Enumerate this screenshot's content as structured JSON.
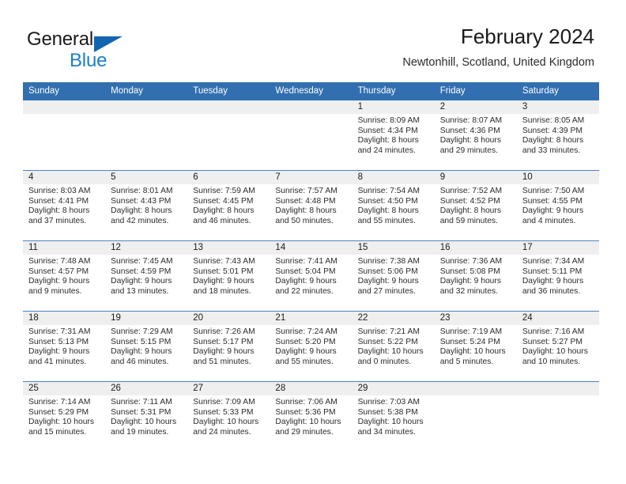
{
  "brand": {
    "name_part1": "General",
    "name_part2": "Blue",
    "logo_icon": "blue-triangle-icon"
  },
  "header": {
    "title": "February 2024",
    "subtitle": "Newtonhill, Scotland, United Kingdom"
  },
  "colors": {
    "header_blue": "#316fb0",
    "brand_blue": "#1a7ed1",
    "daynum_strip": "#efefef",
    "row_separator": "#4a86c4",
    "text": "#2b2b2b"
  },
  "weekday_headers": [
    "Sunday",
    "Monday",
    "Tuesday",
    "Wednesday",
    "Thursday",
    "Friday",
    "Saturday"
  ],
  "labels": {
    "sunrise_prefix": "Sunrise:",
    "sunset_prefix": "Sunset:",
    "daylight_prefix": "Daylight:"
  },
  "weeks": [
    [
      {
        "day": "",
        "empty": true,
        "line1": "",
        "line2": "",
        "line3": "",
        "line4": ""
      },
      {
        "day": "",
        "empty": true,
        "line1": "",
        "line2": "",
        "line3": "",
        "line4": ""
      },
      {
        "day": "",
        "empty": true,
        "line1": "",
        "line2": "",
        "line3": "",
        "line4": ""
      },
      {
        "day": "",
        "empty": true,
        "line1": "",
        "line2": "",
        "line3": "",
        "line4": ""
      },
      {
        "day": "1",
        "empty": false,
        "line1": "Sunrise: 8:09 AM",
        "line2": "Sunset: 4:34 PM",
        "line3": "Daylight: 8 hours",
        "line4": "and 24 minutes."
      },
      {
        "day": "2",
        "empty": false,
        "line1": "Sunrise: 8:07 AM",
        "line2": "Sunset: 4:36 PM",
        "line3": "Daylight: 8 hours",
        "line4": "and 29 minutes."
      },
      {
        "day": "3",
        "empty": false,
        "line1": "Sunrise: 8:05 AM",
        "line2": "Sunset: 4:39 PM",
        "line3": "Daylight: 8 hours",
        "line4": "and 33 minutes."
      }
    ],
    [
      {
        "day": "4",
        "empty": false,
        "line1": "Sunrise: 8:03 AM",
        "line2": "Sunset: 4:41 PM",
        "line3": "Daylight: 8 hours",
        "line4": "and 37 minutes."
      },
      {
        "day": "5",
        "empty": false,
        "line1": "Sunrise: 8:01 AM",
        "line2": "Sunset: 4:43 PM",
        "line3": "Daylight: 8 hours",
        "line4": "and 42 minutes."
      },
      {
        "day": "6",
        "empty": false,
        "line1": "Sunrise: 7:59 AM",
        "line2": "Sunset: 4:45 PM",
        "line3": "Daylight: 8 hours",
        "line4": "and 46 minutes."
      },
      {
        "day": "7",
        "empty": false,
        "line1": "Sunrise: 7:57 AM",
        "line2": "Sunset: 4:48 PM",
        "line3": "Daylight: 8 hours",
        "line4": "and 50 minutes."
      },
      {
        "day": "8",
        "empty": false,
        "line1": "Sunrise: 7:54 AM",
        "line2": "Sunset: 4:50 PM",
        "line3": "Daylight: 8 hours",
        "line4": "and 55 minutes."
      },
      {
        "day": "9",
        "empty": false,
        "line1": "Sunrise: 7:52 AM",
        "line2": "Sunset: 4:52 PM",
        "line3": "Daylight: 8 hours",
        "line4": "and 59 minutes."
      },
      {
        "day": "10",
        "empty": false,
        "line1": "Sunrise: 7:50 AM",
        "line2": "Sunset: 4:55 PM",
        "line3": "Daylight: 9 hours",
        "line4": "and 4 minutes."
      }
    ],
    [
      {
        "day": "11",
        "empty": false,
        "line1": "Sunrise: 7:48 AM",
        "line2": "Sunset: 4:57 PM",
        "line3": "Daylight: 9 hours",
        "line4": "and 9 minutes."
      },
      {
        "day": "12",
        "empty": false,
        "line1": "Sunrise: 7:45 AM",
        "line2": "Sunset: 4:59 PM",
        "line3": "Daylight: 9 hours",
        "line4": "and 13 minutes."
      },
      {
        "day": "13",
        "empty": false,
        "line1": "Sunrise: 7:43 AM",
        "line2": "Sunset: 5:01 PM",
        "line3": "Daylight: 9 hours",
        "line4": "and 18 minutes."
      },
      {
        "day": "14",
        "empty": false,
        "line1": "Sunrise: 7:41 AM",
        "line2": "Sunset: 5:04 PM",
        "line3": "Daylight: 9 hours",
        "line4": "and 22 minutes."
      },
      {
        "day": "15",
        "empty": false,
        "line1": "Sunrise: 7:38 AM",
        "line2": "Sunset: 5:06 PM",
        "line3": "Daylight: 9 hours",
        "line4": "and 27 minutes."
      },
      {
        "day": "16",
        "empty": false,
        "line1": "Sunrise: 7:36 AM",
        "line2": "Sunset: 5:08 PM",
        "line3": "Daylight: 9 hours",
        "line4": "and 32 minutes."
      },
      {
        "day": "17",
        "empty": false,
        "line1": "Sunrise: 7:34 AM",
        "line2": "Sunset: 5:11 PM",
        "line3": "Daylight: 9 hours",
        "line4": "and 36 minutes."
      }
    ],
    [
      {
        "day": "18",
        "empty": false,
        "line1": "Sunrise: 7:31 AM",
        "line2": "Sunset: 5:13 PM",
        "line3": "Daylight: 9 hours",
        "line4": "and 41 minutes."
      },
      {
        "day": "19",
        "empty": false,
        "line1": "Sunrise: 7:29 AM",
        "line2": "Sunset: 5:15 PM",
        "line3": "Daylight: 9 hours",
        "line4": "and 46 minutes."
      },
      {
        "day": "20",
        "empty": false,
        "line1": "Sunrise: 7:26 AM",
        "line2": "Sunset: 5:17 PM",
        "line3": "Daylight: 9 hours",
        "line4": "and 51 minutes."
      },
      {
        "day": "21",
        "empty": false,
        "line1": "Sunrise: 7:24 AM",
        "line2": "Sunset: 5:20 PM",
        "line3": "Daylight: 9 hours",
        "line4": "and 55 minutes."
      },
      {
        "day": "22",
        "empty": false,
        "line1": "Sunrise: 7:21 AM",
        "line2": "Sunset: 5:22 PM",
        "line3": "Daylight: 10 hours",
        "line4": "and 0 minutes."
      },
      {
        "day": "23",
        "empty": false,
        "line1": "Sunrise: 7:19 AM",
        "line2": "Sunset: 5:24 PM",
        "line3": "Daylight: 10 hours",
        "line4": "and 5 minutes."
      },
      {
        "day": "24",
        "empty": false,
        "line1": "Sunrise: 7:16 AM",
        "line2": "Sunset: 5:27 PM",
        "line3": "Daylight: 10 hours",
        "line4": "and 10 minutes."
      }
    ],
    [
      {
        "day": "25",
        "empty": false,
        "line1": "Sunrise: 7:14 AM",
        "line2": "Sunset: 5:29 PM",
        "line3": "Daylight: 10 hours",
        "line4": "and 15 minutes."
      },
      {
        "day": "26",
        "empty": false,
        "line1": "Sunrise: 7:11 AM",
        "line2": "Sunset: 5:31 PM",
        "line3": "Daylight: 10 hours",
        "line4": "and 19 minutes."
      },
      {
        "day": "27",
        "empty": false,
        "line1": "Sunrise: 7:09 AM",
        "line2": "Sunset: 5:33 PM",
        "line3": "Daylight: 10 hours",
        "line4": "and 24 minutes."
      },
      {
        "day": "28",
        "empty": false,
        "line1": "Sunrise: 7:06 AM",
        "line2": "Sunset: 5:36 PM",
        "line3": "Daylight: 10 hours",
        "line4": "and 29 minutes."
      },
      {
        "day": "29",
        "empty": false,
        "line1": "Sunrise: 7:03 AM",
        "line2": "Sunset: 5:38 PM",
        "line3": "Daylight: 10 hours",
        "line4": "and 34 minutes."
      },
      {
        "day": "",
        "empty": true,
        "line1": "",
        "line2": "",
        "line3": "",
        "line4": ""
      },
      {
        "day": "",
        "empty": true,
        "line1": "",
        "line2": "",
        "line3": "",
        "line4": ""
      }
    ]
  ]
}
